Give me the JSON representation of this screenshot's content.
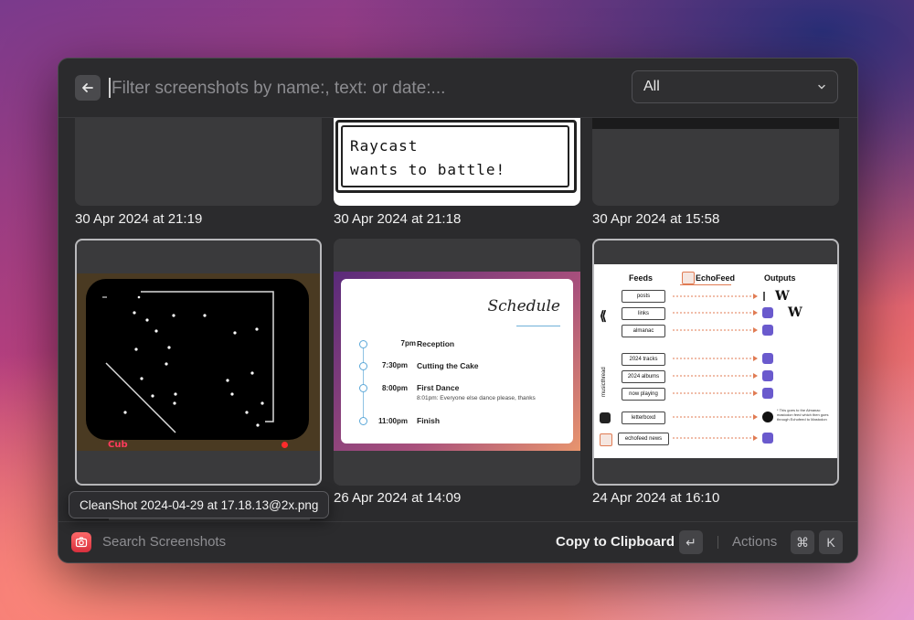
{
  "search": {
    "placeholder": "Filter screenshots by name:, text: or date:..."
  },
  "filter": {
    "selected": "All"
  },
  "tiles": [
    {
      "caption": "30 Apr 2024 at 21:19"
    },
    {
      "caption": "30 Apr 2024 at 21:18",
      "content": {
        "line1": "Raycast",
        "line2": "wants to battle!"
      }
    },
    {
      "caption": "30 Apr 2024 at 15:58"
    },
    {
      "caption": "",
      "logo": "Cub"
    },
    {
      "caption": "26 Apr 2024 at 14:09",
      "content": {
        "title": "Schedule",
        "events": [
          {
            "time": "7pm",
            "name": "Reception",
            "note": ""
          },
          {
            "time": "7:30pm",
            "name": "Cutting the Cake",
            "note": ""
          },
          {
            "time": "8:00pm",
            "name": "First Dance",
            "note": "8:01pm: Everyone else dance please, thanks"
          },
          {
            "time": "11:00pm",
            "name": "Finish",
            "note": ""
          }
        ]
      }
    },
    {
      "caption": "24 Apr 2024 at 16:10",
      "content": {
        "feeds_heading": "Feeds",
        "brand": "EchoFeed",
        "outputs_heading": "Outputs",
        "group_label": "musicthread",
        "rows": [
          "posts",
          "links",
          "almanac",
          "2024 tracks",
          "2024 albums",
          "now playing",
          "letterboxd",
          "echofeed news"
        ],
        "note": "* This goes to the Almanac mastodon feed which then goes through Echofeed to Mastodon"
      }
    }
  ],
  "tooltip": {
    "text": "CleanShot 2024-04-29 at 17.18.13@2x.png"
  },
  "footer": {
    "title": "Search Screenshots",
    "primary_action": "Copy to Clipboard",
    "primary_key": "↵",
    "actions_label": "Actions",
    "actions_keys": [
      "⌘",
      "K"
    ]
  }
}
